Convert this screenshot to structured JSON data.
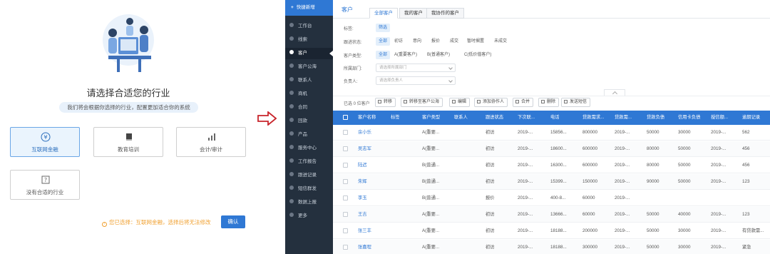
{
  "onboarding": {
    "title": "请选择合适您的行业",
    "subtitle": "我们将会根据你选择的行业，配置更加适合你的系统",
    "industries": [
      {
        "label": "互联网金融",
        "icon": "yen-icon",
        "selected": true
      },
      {
        "label": "教育培训",
        "icon": "book-icon",
        "selected": false
      },
      {
        "label": "会计/审计",
        "icon": "bar-chart-icon",
        "selected": false
      },
      {
        "label": "没有合适的行业",
        "icon": "help-doc-icon",
        "selected": false
      }
    ],
    "note": "您已选择：互联网金融，选择后将无法修改",
    "confirm_label": "确认"
  },
  "crm": {
    "quick_new": "快捷新增",
    "nav": [
      {
        "label": "工作台"
      },
      {
        "label": "线索"
      },
      {
        "label": "客户",
        "active": true
      },
      {
        "label": "客户公海"
      },
      {
        "label": "联系人"
      },
      {
        "label": "商机"
      },
      {
        "label": "合同"
      },
      {
        "label": "回款"
      },
      {
        "label": "产品"
      },
      {
        "label": "服务中心"
      },
      {
        "label": "工作报告"
      },
      {
        "label": "跟进记录"
      },
      {
        "label": "短信群发"
      },
      {
        "label": "数据上报"
      },
      {
        "label": "更多"
      }
    ],
    "page_name": "客户",
    "tabs": [
      {
        "label": "全部客户",
        "active": true
      },
      {
        "label": "我的客户"
      },
      {
        "label": "我协作的客户"
      }
    ],
    "filters": {
      "tag_label": "标签:",
      "tag_chip": "筛选",
      "status_label": "跟进状态:",
      "status_options": [
        "全部",
        "初访",
        "意向",
        "报价",
        "成交",
        "暂时搁置",
        "未成交"
      ],
      "type_label": "客户类型:",
      "type_options": [
        "全部",
        "A(重要客户)",
        "B(普通客户)",
        "C(低价值客户)"
      ],
      "dept_label": "所属部门:",
      "dept_placeholder": "请选择所属部门",
      "owner_label": "负责人:",
      "owner_placeholder": "请选择负责人"
    },
    "toolbar": {
      "count": "已选 0 位客户",
      "buttons": [
        "转移",
        "转移至客户公海",
        "编辑",
        "添加协作人",
        "合并",
        "删除",
        "发送短信"
      ]
    },
    "table": {
      "columns": [
        "客户名称",
        "标签",
        "客户类型",
        "联系人",
        "跟进状态",
        "下次联...",
        "电话",
        "贷款需求...",
        "贷款需...",
        "贷款负债",
        "信用卡负债",
        "授信额...",
        "逾期记录"
      ],
      "rows": [
        [
          "余小乐",
          "",
          "A(重要...",
          "",
          "初访",
          "2019-...",
          "15856...",
          "800000",
          "2019-...",
          "50000",
          "30000",
          "2019-...",
          "562"
        ],
        [
          "吴志军",
          "",
          "A(重要...",
          "",
          "初访",
          "2019-...",
          "18600...",
          "600000",
          "2019-...",
          "80000",
          "50000",
          "2019-...",
          "456"
        ],
        [
          "陆迟",
          "",
          "B(普通...",
          "",
          "初访",
          "2019-...",
          "16300...",
          "600000",
          "2019-...",
          "80000",
          "50000",
          "2019-...",
          "456"
        ],
        [
          "朱辉",
          "",
          "B(普通...",
          "",
          "初访",
          "2019-...",
          "15399...",
          "150000",
          "2019-...",
          "90000",
          "50000",
          "2019-...",
          "123"
        ],
        [
          "李玉",
          "",
          "B(普通...",
          "",
          "报价",
          "2019-...",
          "400-8...",
          "60000",
          "2019-...",
          "",
          "",
          "",
          ""
        ],
        [
          "王吉",
          "",
          "A(重要...",
          "",
          "初访",
          "2019-...",
          "13666...",
          "60000",
          "2019-...",
          "50000",
          "40000",
          "2019-...",
          "123"
        ],
        [
          "张三丰",
          "",
          "A(重要...",
          "",
          "初访",
          "2019-...",
          "18188...",
          "200000",
          "2019-...",
          "50000",
          "30000",
          "2019-...",
          "有贷款需..."
        ],
        [
          "张嘉程",
          "",
          "A(重要...",
          "",
          "初访",
          "2019-...",
          "18188...",
          "300000",
          "2019-...",
          "50000",
          "30000",
          "2019-...",
          "紧急"
        ]
      ]
    }
  },
  "colors": {
    "accent": "#2f78d4",
    "sidebar": "#24303e",
    "note": "#f0a030",
    "arrow": "#c8242b"
  }
}
